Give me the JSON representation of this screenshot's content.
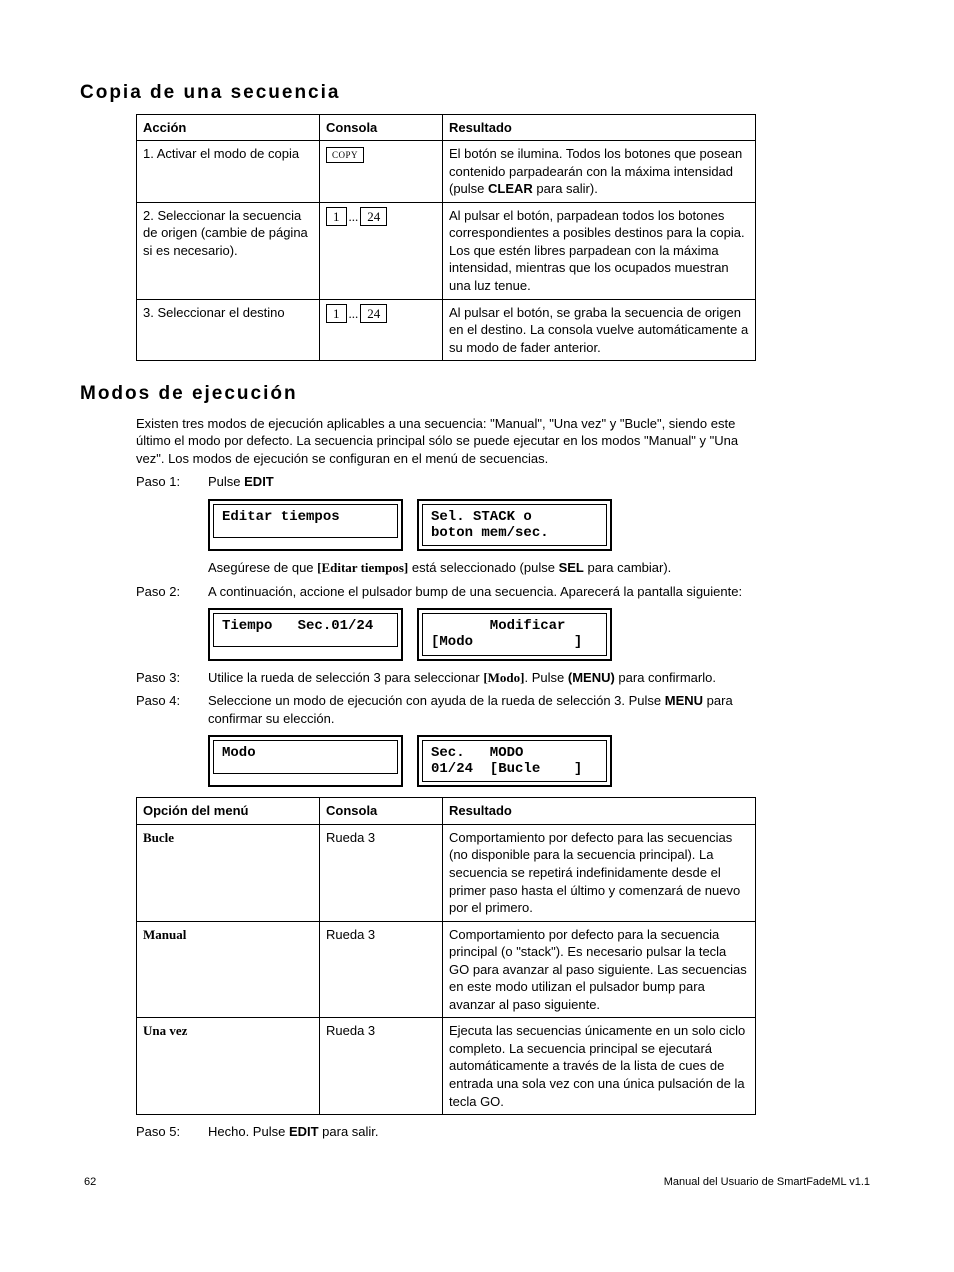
{
  "heading1": "Copia de una secuencia",
  "table1": {
    "h1": "Acción",
    "h2": "Consola",
    "h3": "Resultado",
    "r1c1": "1. Activar el modo de copia",
    "r1c2_key": "COPY",
    "r1c3a": "El botón se ilumina. Todos los botones que posean contenido parpadearán con la máxima intensidad (pulse ",
    "r1c3b": "CLEAR",
    "r1c3c": " para salir).",
    "r2c1": "2. Seleccionar la secuencia de origen (cambie de página si es necesario).",
    "r2c2_a": "1",
    "r2c2_dots": "...",
    "r2c2_b": "24",
    "r2c3": "Al pulsar el botón, parpadean todos los botones correspondientes a posibles destinos para la copia. Los que estén libres parpadean con la máxima intensidad, mientras que los ocupados muestran una luz tenue.",
    "r3c1": "3. Seleccionar el destino",
    "r3c2_a": "1",
    "r3c2_dots": "...",
    "r3c2_b": "24",
    "r3c3": "Al pulsar el botón, se graba la secuencia de origen en el destino. La consola vuelve automáticamente a su modo de fader anterior."
  },
  "heading2": "Modos de ejecución",
  "intro": "Existen tres modos de ejecución aplicables a una secuencia: \"Manual\", \"Una vez\" y \"Bucle\", siendo este último el modo por defecto. La secuencia principal sólo se puede ejecutar en los modos \"Manual\" y \"Una vez\". Los modos de ejecución se configuran en el menú de secuencias.",
  "step1_label": "Paso 1:",
  "step1_a": "Pulse ",
  "step1_b": "EDIT",
  "lcd1a": "Editar tiempos\n",
  "lcd1b": "Sel. STACK o\nboton mem/sec.",
  "step1_note_a": "Asegúrese de que ",
  "step1_note_b": "[Editar tiempos]",
  "step1_note_c": " está seleccionado (pulse ",
  "step1_note_d": "SEL",
  "step1_note_e": " para cambiar).",
  "step2_label": "Paso 2:",
  "step2_body": "A continuación, accione el pulsador bump de una secuencia. Aparecerá la pantalla siguiente:",
  "lcd2a": "Tiempo   Sec.01/24",
  "lcd2b": "       Modificar\n[Modo            ]",
  "step3_label": "Paso 3:",
  "step3_a": "Utilice la rueda de selección 3 para seleccionar ",
  "step3_b": "[Modo]",
  "step3_c": ". Pulse ",
  "step3_d": "(MENU)",
  "step3_e": " para confirmarlo.",
  "step4_label": "Paso 4:",
  "step4_a": "Seleccione un modo de ejecución con ayuda de la rueda de selección 3. Pulse ",
  "step4_b": "MENU",
  "step4_c": " para confirmar su elección.",
  "lcd3a": "Modo\n",
  "lcd3b": "Sec.   MODO\n01/24  [Bucle    ]",
  "table2": {
    "h1": "Opción del menú",
    "h2": "Consola",
    "h3": "Resultado",
    "r1c1": "Bucle",
    "r1c2": "Rueda 3",
    "r1c3": "Comportamiento por defecto para las secuencias (no disponible para la secuencia principal). La secuencia se repetirá indefinidamente desde el primer paso hasta el último y comenzará de nuevo por el primero.",
    "r2c1": "Manual",
    "r2c2": "Rueda 3",
    "r2c3": "Comportamiento por defecto para la secuencia principal (o \"stack\"). Es necesario pulsar la tecla GO para avanzar al paso siguiente. Las secuencias en este modo utilizan el pulsador bump para avanzar al paso siguiente.",
    "r3c1": "Una vez",
    "r3c2": "Rueda 3",
    "r3c3": "Ejecuta las secuencias únicamente en un solo ciclo completo. La secuencia principal se ejecutará automáticamente a través de la lista de cues de entrada una sola vez con una única pulsación de la tecla GO."
  },
  "step5_label": "Paso 5:",
  "step5_a": "Hecho. Pulse ",
  "step5_b": "EDIT",
  "step5_c": " para salir.",
  "footer_left": "62",
  "footer_right": "Manual del Usuario de SmartFadeML v1.1"
}
